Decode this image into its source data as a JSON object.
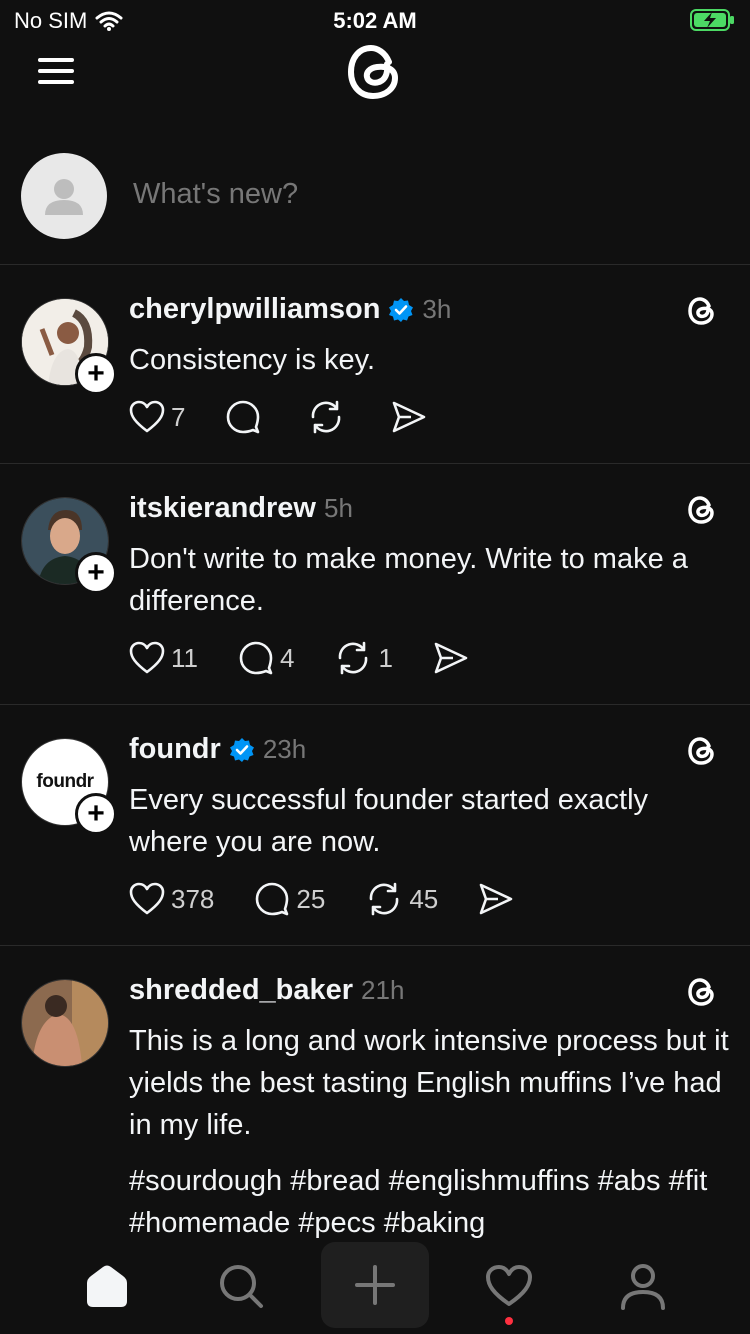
{
  "status_bar": {
    "carrier": "No SIM",
    "time": "5:02 AM"
  },
  "composer": {
    "placeholder": "What's new?"
  },
  "posts": [
    {
      "username": "cherylpwilliamson",
      "verified": true,
      "time": "3h",
      "text": "Consistency is key.",
      "likes": "7",
      "replies": "",
      "reposts": ""
    },
    {
      "username": "itskierandrew",
      "verified": false,
      "time": "5h",
      "text": "Don't write to make money. Write to make a difference.",
      "likes": "11",
      "replies": "4",
      "reposts": "1"
    },
    {
      "username": "foundr",
      "verified": true,
      "time": "23h",
      "text": "Every successful founder started exactly where you are now.",
      "likes": "378",
      "replies": "25",
      "reposts": "45",
      "avatar_text": "foundr"
    },
    {
      "username": "shredded_baker",
      "verified": false,
      "time": "21h",
      "text": "This is a long and work intensive process but it yields the best tasting English muffins I’ve had in my life.",
      "hashtags": "#sourdough #bread #englishmuffins #abs #fit #homemade #pecs #baking"
    }
  ],
  "tabs": [
    "home-icon",
    "search-icon",
    "create-icon",
    "heart-icon",
    "profile-icon"
  ],
  "colors": {
    "background": "#101010",
    "text": "#f3f5f7",
    "muted": "#777777",
    "verified": "#0095f6",
    "notification": "#ff3040"
  }
}
